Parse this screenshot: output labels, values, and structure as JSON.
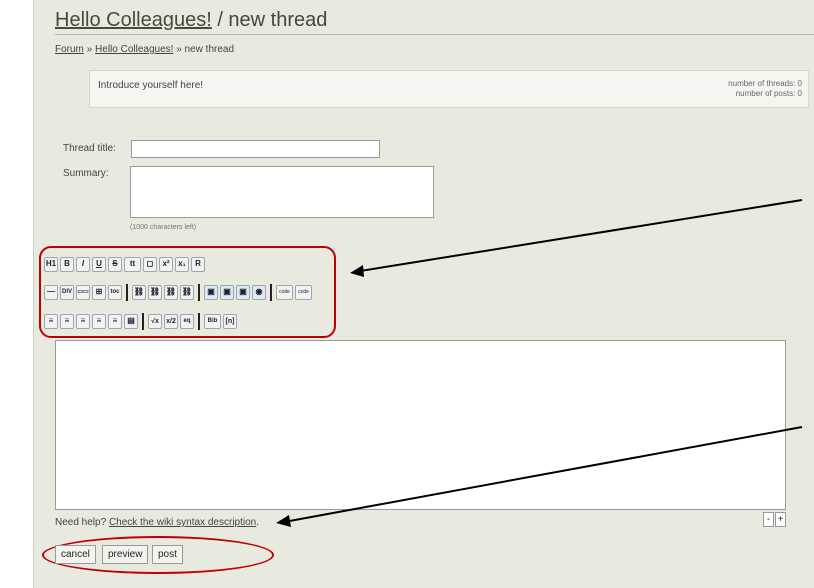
{
  "title": {
    "link": "Hello Colleagues!",
    "rest": " / new thread"
  },
  "breadcrumb": {
    "forum": "Forum",
    "sep1": " » ",
    "category": "Hello Colleagues!",
    "sep2": " » ",
    "current": "new thread"
  },
  "intro": {
    "text": "Introduce yourself here!",
    "threads": "number of threads: 0",
    "posts": "number of posts: 0"
  },
  "form": {
    "thread_title_label": "Thread title:",
    "thread_title_value": "",
    "summary_label": "Summary:",
    "summary_value": "",
    "chars_left": "(1000 characters left)"
  },
  "toolbar": {
    "row1": [
      "H1",
      "B",
      "I",
      "U",
      "S",
      "tt",
      "◻",
      "x²",
      "x₁",
      "R"
    ],
    "row2a": [
      "—",
      "DIV",
      "▭▭",
      "⊞",
      "toc"
    ],
    "row2b": [
      "⛓",
      "⛓",
      "⛓",
      "⛓"
    ],
    "row2c": [
      "▣",
      "▣",
      "▣",
      "◉"
    ],
    "row2d": [
      "code",
      "code"
    ],
    "row3a": [
      "≡",
      "≡",
      "≡",
      "≡",
      "≡",
      "▤"
    ],
    "row3b": [
      "√x",
      "x/2",
      "eq"
    ],
    "row3c": [
      "Bib",
      "[n]"
    ]
  },
  "help": {
    "prefix": "Need help? ",
    "link": "Check the wiki syntax description",
    "suffix": "."
  },
  "resize": {
    "minus": "-",
    "plus": "+"
  },
  "buttons": {
    "cancel": "cancel",
    "preview": "preview",
    "post": "post"
  },
  "colors": {
    "annotation": "#c00000",
    "background": "#e8e9df"
  }
}
